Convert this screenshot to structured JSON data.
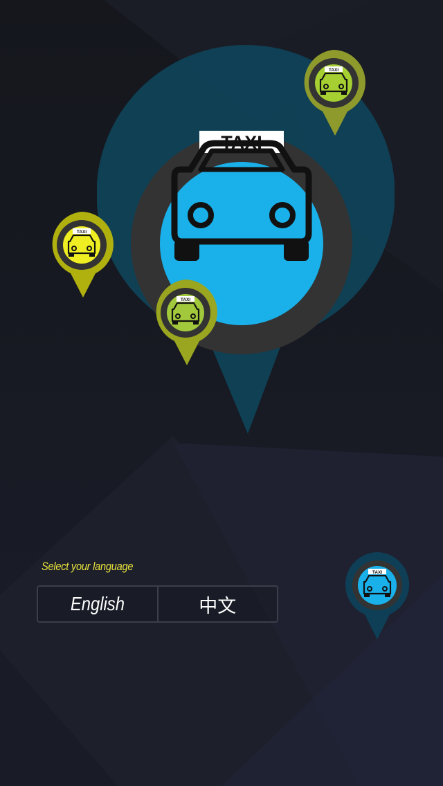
{
  "hero_pin": {
    "sign_text": "TAXI",
    "icon": "taxi-icon",
    "colors": {
      "halo": "#0f4257",
      "ring": "#333333",
      "disc": "#1ab1ea",
      "car": "#111111",
      "sign_bg": "#ffffff"
    }
  },
  "small_pins": [
    {
      "name": "pin-top-right",
      "sign_text": "TAXI",
      "halo": "#8f9a2c",
      "disc": "#a6cf32"
    },
    {
      "name": "pin-left",
      "sign_text": "TAXI",
      "halo": "#b0b10f",
      "disc": "#eeee22"
    },
    {
      "name": "pin-mid",
      "sign_text": "TAXI",
      "halo": "#9aa520",
      "disc": "#a2c83c"
    },
    {
      "name": "pin-bottom-right",
      "sign_text": "TAXI",
      "halo": "#0e3f57",
      "disc": "#1ab1ea"
    }
  ],
  "language": {
    "prompt": "Select your language",
    "options": [
      {
        "label": "English"
      },
      {
        "label": "中文"
      }
    ]
  },
  "colors": {
    "background": "#16181f",
    "prompt_text": "#e9e43a",
    "button_text": "#ffffff",
    "button_border": "#3b3f4b"
  }
}
